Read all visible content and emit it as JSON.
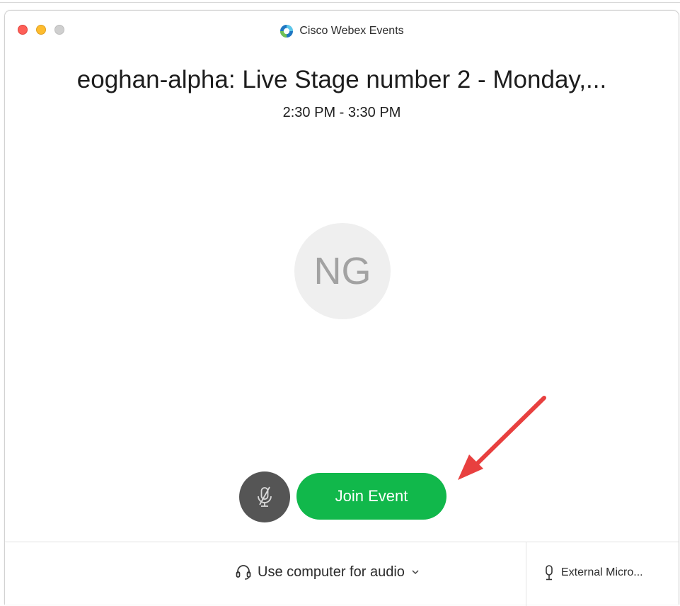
{
  "window": {
    "title": "Cisco Webex Events"
  },
  "meeting": {
    "title": "eoghan-alpha: Live Stage number 2 - Monday,...",
    "time": "2:30 PM - 3:30 PM"
  },
  "avatar": {
    "initials": "NG"
  },
  "controls": {
    "join_label": "Join Event"
  },
  "footer": {
    "audio_option": "Use computer for audio",
    "microphone": "External Micro..."
  },
  "colors": {
    "join_green": "#11b84b",
    "mute_gray": "#555555",
    "annotation_arrow": "#e8403f"
  },
  "icons": {
    "logo": "webex-logo-icon",
    "mute": "microphone-muted-icon",
    "headset": "headset-icon",
    "dropdown": "chevron-down-icon",
    "mic": "microphone-icon"
  }
}
